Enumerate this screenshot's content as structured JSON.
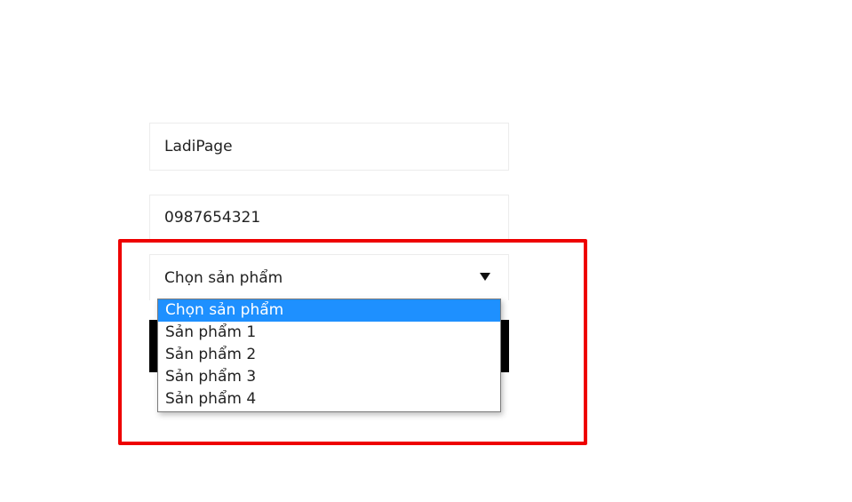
{
  "form": {
    "name_value": "LadiPage",
    "phone_value": "0987654321",
    "product_select": {
      "selected": "Chọn sản phẩm",
      "options": [
        "Chọn sản phẩm",
        "Sản phẩm 1",
        "Sản phẩm 2",
        "Sản phẩm 3",
        "Sản phẩm 4"
      ]
    }
  },
  "colors": {
    "highlight": "#ee0000",
    "option_selected": "#1e90ff",
    "submit": "#000000"
  }
}
